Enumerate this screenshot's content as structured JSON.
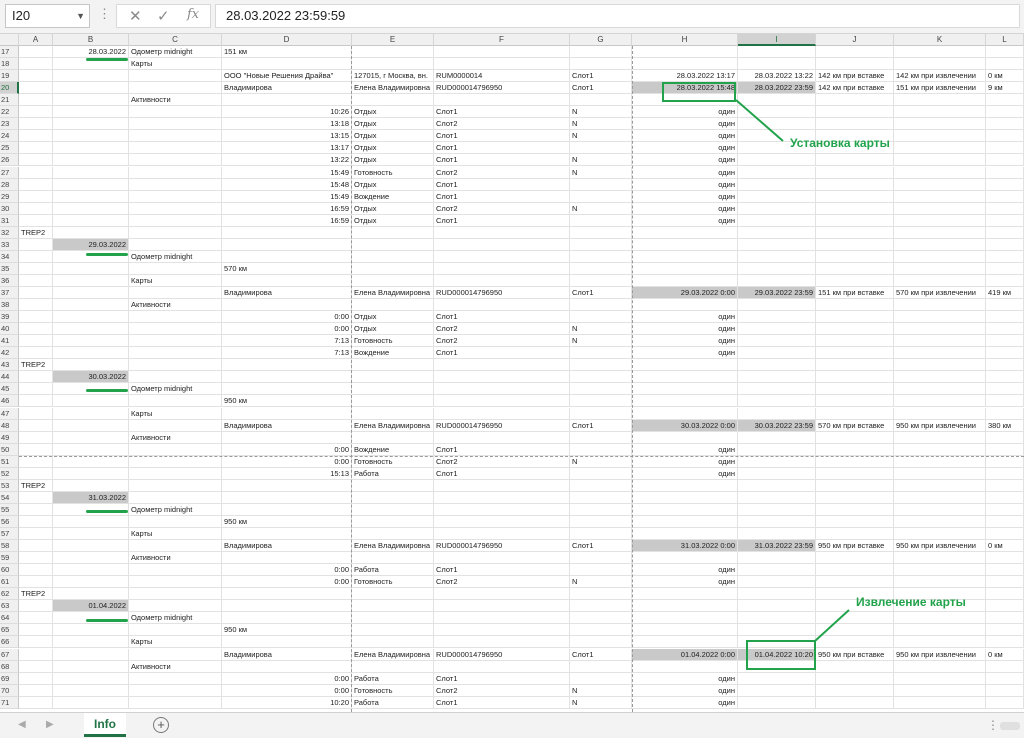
{
  "formula_bar": {
    "name_box": "I20",
    "dots": "⋮",
    "cancel_icon": "✕",
    "enter_icon": "✓",
    "fx_icon": "fx",
    "value": "28.03.2022  23:59:59"
  },
  "columns": [
    "A",
    "B",
    "C",
    "D",
    "E",
    "F",
    "G",
    "H",
    "I",
    "J",
    "K",
    "L"
  ],
  "rows": [
    {
      "n": "17",
      "cells": {
        "B": "28.03.2022",
        "C": "Одометр midnight",
        "D": "151 км"
      }
    },
    {
      "n": "18",
      "cells": {
        "C": "Карты"
      }
    },
    {
      "n": "19",
      "cells": {
        "D": "ООО \"Новые Решения Драйва\"",
        "E": "127015, г Москва, вн.",
        "F": "RUM0000014",
        "G": "Слот1",
        "H": "28.03.2022 13:17",
        "I": "28.03.2022 13:22",
        "J": "142 км при вставке",
        "K": "142 км при извлечении",
        "L": "0 км"
      }
    },
    {
      "n": "20",
      "cells": {
        "D": "Владимирова",
        "E": "Елена Владимировна",
        "F": "RUD000014796950",
        "G": "Слот1",
        "H": "28.03.2022 15:48",
        "I": "28.03.2022 23:59",
        "J": "142 км при вставке",
        "K": "151 км при извлечении",
        "L": "9 км"
      }
    },
    {
      "n": "21",
      "cells": {
        "C": "Активности"
      }
    },
    {
      "n": "22",
      "cells": {
        "D": "10:26",
        "E": "Отдых",
        "F": "Слот1",
        "G": "N",
        "H": "один"
      }
    },
    {
      "n": "23",
      "cells": {
        "D": "13:18",
        "E": "Отдых",
        "F": "Слот2",
        "G": "N",
        "H": "один"
      }
    },
    {
      "n": "24",
      "cells": {
        "D": "13:15",
        "E": "Отдых",
        "F": "Слот1",
        "G": "N",
        "H": "один"
      }
    },
    {
      "n": "25",
      "cells": {
        "D": "13:17",
        "E": "Отдых",
        "F": "Слот1",
        "H": "один"
      }
    },
    {
      "n": "26",
      "cells": {
        "D": "13:22",
        "E": "Отдых",
        "F": "Слот1",
        "G": "N",
        "H": "один"
      }
    },
    {
      "n": "27",
      "cells": {
        "D": "15:49",
        "E": "Готовность",
        "F": "Слот2",
        "G": "N",
        "H": "один"
      }
    },
    {
      "n": "28",
      "cells": {
        "D": "15:48",
        "E": "Отдых",
        "F": "Слот1",
        "H": "один"
      }
    },
    {
      "n": "29",
      "cells": {
        "D": "15:49",
        "E": "Вождение",
        "F": "Слот1",
        "H": "один"
      }
    },
    {
      "n": "30",
      "cells": {
        "D": "16:59",
        "E": "Отдых",
        "F": "Слот2",
        "G": "N",
        "H": "один"
      }
    },
    {
      "n": "31",
      "cells": {
        "D": "16:59",
        "E": "Отдых",
        "F": "Слот1",
        "H": "один"
      }
    },
    {
      "n": "32",
      "cells": {
        "A": "TREP2"
      }
    },
    {
      "n": "33",
      "cells": {
        "B": "29.03.2022"
      }
    },
    {
      "n": "34",
      "cells": {
        "C": "Одометр midnight"
      }
    },
    {
      "n": "35",
      "cells": {
        "D": "570 км"
      }
    },
    {
      "n": "36",
      "cells": {
        "C": "Карты"
      }
    },
    {
      "n": "37",
      "cells": {
        "D": "Владимирова",
        "E": "Елена Владимировна",
        "F": "RUD000014796950",
        "G": "Слот1",
        "H": "29.03.2022 0:00",
        "I": "29.03.2022 23:59",
        "J": "151 км при вставке",
        "K": "570 км при извлечении",
        "L": "419 км"
      }
    },
    {
      "n": "38",
      "cells": {
        "C": "Активности"
      }
    },
    {
      "n": "39",
      "cells": {
        "D": "0:00",
        "E": "Отдых",
        "F": "Слот1",
        "H": "один"
      }
    },
    {
      "n": "40",
      "cells": {
        "D": "0:00",
        "E": "Отдых",
        "F": "Слот2",
        "G": "N",
        "H": "один"
      }
    },
    {
      "n": "41",
      "cells": {
        "D": "7:13",
        "E": "Готовность",
        "F": "Слот2",
        "G": "N",
        "H": "один"
      }
    },
    {
      "n": "42",
      "cells": {
        "D": "7:13",
        "E": "Вождение",
        "F": "Слот1",
        "H": "один"
      }
    },
    {
      "n": "43",
      "cells": {
        "A": "TREP2"
      }
    },
    {
      "n": "44",
      "cells": {
        "B": "30.03.2022"
      }
    },
    {
      "n": "45",
      "cells": {
        "C": "Одометр midnight"
      }
    },
    {
      "n": "46",
      "cells": {
        "D": "950 км"
      }
    },
    {
      "n": "47",
      "cells": {
        "C": "Карты"
      }
    },
    {
      "n": "48",
      "cells": {
        "D": "Владимирова",
        "E": "Елена Владимировна",
        "F": "RUD000014796950",
        "G": "Слот1",
        "H": "30.03.2022 0:00",
        "I": "30.03.2022 23:59",
        "J": "570 км при вставке",
        "K": "950 км при извлечении",
        "L": "380 км"
      }
    },
    {
      "n": "49",
      "cells": {
        "C": "Активности"
      }
    },
    {
      "n": "50",
      "cells": {
        "D": "0:00",
        "E": "Вождение",
        "F": "Слот1",
        "H": "один"
      }
    },
    {
      "n": "51",
      "cells": {
        "D": "0:00",
        "E": "Готовность",
        "F": "Слот2",
        "G": "N",
        "H": "один"
      }
    },
    {
      "n": "52",
      "cells": {
        "D": "15:13",
        "E": "Работа",
        "F": "Слот1",
        "H": "один"
      }
    },
    {
      "n": "53",
      "cells": {
        "A": "TREP2"
      }
    },
    {
      "n": "54",
      "cells": {
        "B": "31.03.2022"
      }
    },
    {
      "n": "55",
      "cells": {
        "C": "Одометр midnight"
      }
    },
    {
      "n": "56",
      "cells": {
        "D": "950 км"
      }
    },
    {
      "n": "57",
      "cells": {
        "C": "Карты"
      }
    },
    {
      "n": "58",
      "cells": {
        "D": "Владимирова",
        "E": "Елена Владимировна",
        "F": "RUD000014796950",
        "G": "Слот1",
        "H": "31.03.2022 0:00",
        "I": "31.03.2022 23:59",
        "J": "950 км при вставке",
        "K": "950 км при извлечении",
        "L": "0 км"
      }
    },
    {
      "n": "59",
      "cells": {
        "C": "Активности"
      }
    },
    {
      "n": "60",
      "cells": {
        "D": "0:00",
        "E": "Работа",
        "F": "Слот1",
        "H": "один"
      }
    },
    {
      "n": "61",
      "cells": {
        "D": "0:00",
        "E": "Готовность",
        "F": "Слот2",
        "G": "N",
        "H": "один"
      }
    },
    {
      "n": "62",
      "cells": {
        "A": "TREP2"
      }
    },
    {
      "n": "63",
      "cells": {
        "B": "01.04.2022"
      }
    },
    {
      "n": "64",
      "cells": {
        "C": "Одометр midnight"
      }
    },
    {
      "n": "65",
      "cells": {
        "D": "950 км"
      }
    },
    {
      "n": "66",
      "cells": {
        "C": "Карты"
      }
    },
    {
      "n": "67",
      "cells": {
        "D": "Владимирова",
        "E": "Елена Владимировна",
        "F": "RUD000014796950",
        "G": "Слот1",
        "H": "01.04.2022 0:00",
        "I": "01.04.2022 10:20",
        "J": "950 км при вставке",
        "K": "950 км при извлечении",
        "L": "0 км"
      }
    },
    {
      "n": "68",
      "cells": {
        "C": "Активности"
      }
    },
    {
      "n": "69",
      "cells": {
        "D": "0:00",
        "E": "Работа",
        "F": "Слот1",
        "H": "один"
      }
    },
    {
      "n": "70",
      "cells": {
        "D": "0:00",
        "E": "Готовность",
        "F": "Слот2",
        "G": "N",
        "H": "один"
      }
    },
    {
      "n": "71",
      "cells": {
        "D": "10:20",
        "E": "Работа",
        "F": "Слот1",
        "G": "N",
        "H": "один"
      }
    }
  ],
  "annotations": {
    "card_insert_label": "Установка карты",
    "card_remove_label": "Извлечение карты"
  },
  "sheet_tabs": {
    "prev_icon": "◀",
    "next_icon": "▶",
    "active_tab": "Info",
    "add_icon": "+",
    "more_icon": "⋮"
  },
  "colors": {
    "annotation_green": "#22a34b",
    "excel_green": "#217346",
    "date_highlight": "#c9c9c9"
  }
}
